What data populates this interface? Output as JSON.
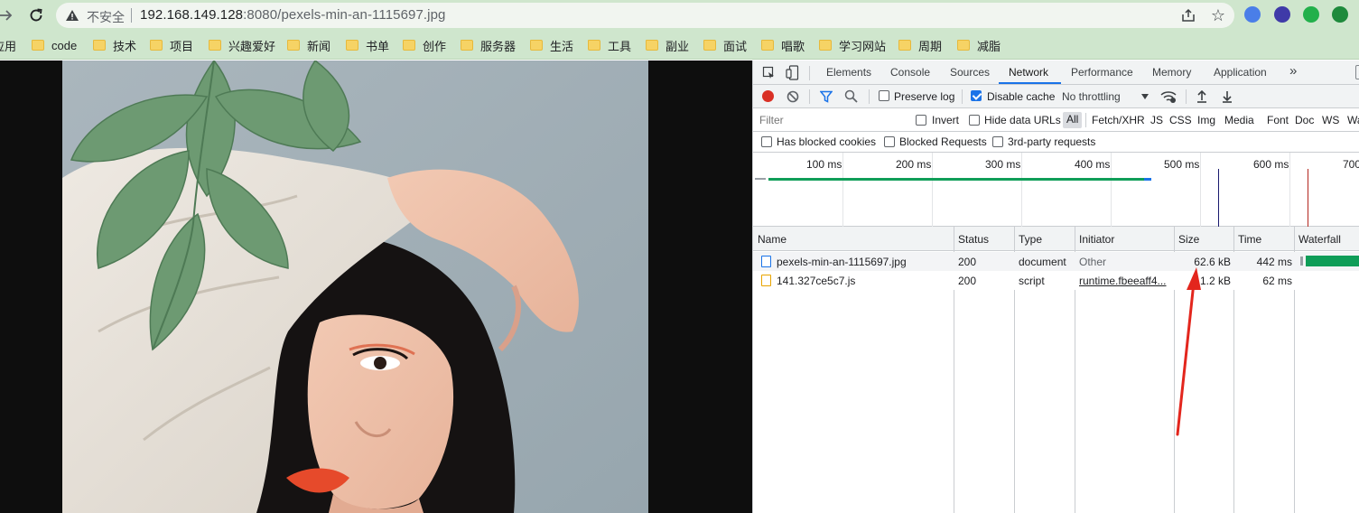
{
  "browser": {
    "address": {
      "security_label": "不安全",
      "host": "192.168.149.128",
      "port": ":8080",
      "path": "/pexels-min-an-1115697.jpg"
    },
    "bookmarks": [
      {
        "label": "应用"
      },
      {
        "label": "code"
      },
      {
        "label": "技术"
      },
      {
        "label": "项目"
      },
      {
        "label": "兴趣爱好"
      },
      {
        "label": "新闻"
      },
      {
        "label": "书单"
      },
      {
        "label": "创作"
      },
      {
        "label": "服务器"
      },
      {
        "label": "生活"
      },
      {
        "label": "工具"
      },
      {
        "label": "副业"
      },
      {
        "label": "面试"
      },
      {
        "label": "唱歌"
      },
      {
        "label": "学习网站"
      },
      {
        "label": "周期"
      },
      {
        "label": "减脂"
      }
    ],
    "colors": {
      "chrome": "#cfe6cd",
      "omnibox": "#f1f5f0"
    }
  },
  "devtools": {
    "tabs": [
      "Elements",
      "Console",
      "Sources",
      "Network",
      "Performance",
      "Memory",
      "Application"
    ],
    "active_tab": "Network",
    "toolbar": {
      "preserve_log": "Preserve log",
      "preserve_log_checked": false,
      "disable_cache": "Disable cache",
      "disable_cache_checked": true,
      "throttling": "No throttling"
    },
    "filter": {
      "placeholder": "Filter",
      "invert": "Invert",
      "hide_data_urls": "Hide data URLs",
      "types": [
        "All",
        "Fetch/XHR",
        "JS",
        "CSS",
        "Img",
        "Media",
        "Font",
        "Doc",
        "WS",
        "Wa"
      ],
      "has_blocked_cookies": "Has blocked cookies",
      "blocked_requests": "Blocked Requests",
      "third_party": "3rd-party requests"
    },
    "overview_ticks": [
      "100 ms",
      "200 ms",
      "300 ms",
      "400 ms",
      "500 ms",
      "600 ms",
      "700"
    ],
    "columns": [
      "Name",
      "Status",
      "Type",
      "Initiator",
      "Size",
      "Time",
      "Waterfall"
    ],
    "requests": [
      {
        "name": "pexels-min-an-1115697.jpg",
        "status": "200",
        "type": "document",
        "initiator": "Other",
        "size": "62.6 kB",
        "time": "442 ms",
        "icon": "document-icon"
      },
      {
        "name": "141.327ce5c7.js",
        "status": "200",
        "type": "script",
        "initiator": "runtime.fbeeaff4...",
        "size": "1.2 kB",
        "time": "62 ms",
        "icon": "script-icon"
      }
    ],
    "colors": {
      "accent": "#1a73e8",
      "record": "#d93025",
      "waterfall": "#0f9d58",
      "annotation": "#e3261d"
    }
  }
}
